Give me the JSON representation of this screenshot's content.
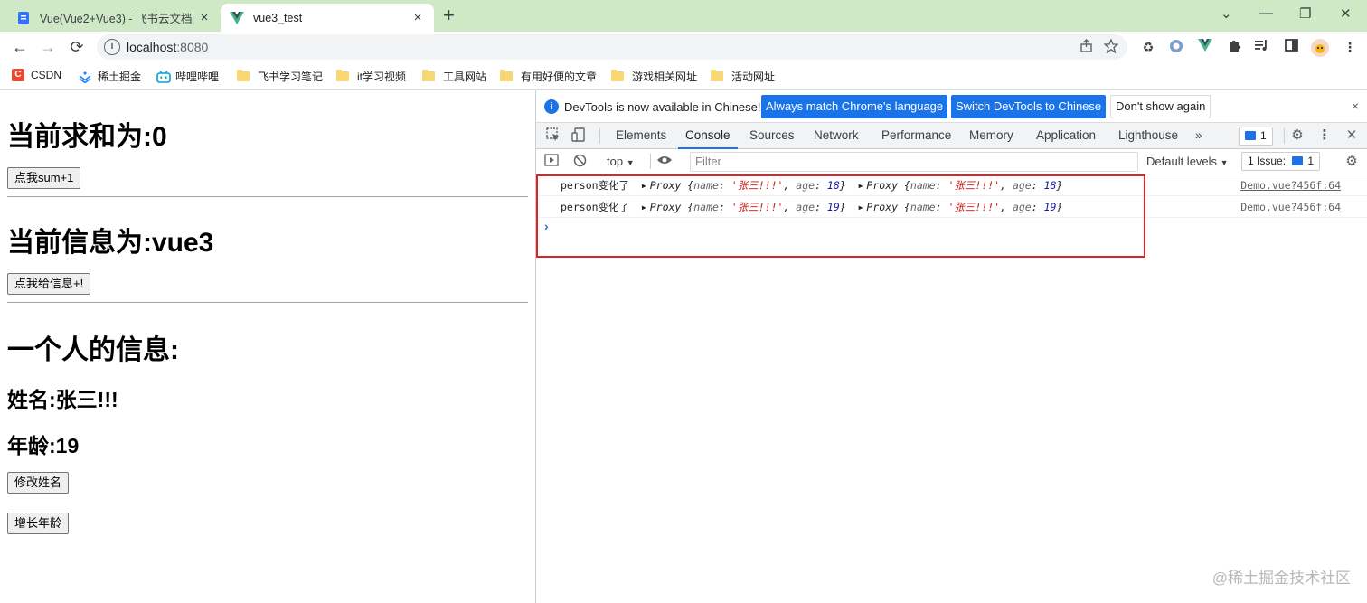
{
  "browser": {
    "tabs": [
      {
        "title": "Vue(Vue2+Vue3) - 飞书云文档",
        "close": "×"
      },
      {
        "title": "vue3_test",
        "close": "×"
      }
    ],
    "new_tab": "+",
    "window_controls": {
      "minimize": "—",
      "restore": "❐",
      "close": "✕",
      "dropdown": "⌄"
    },
    "toolbar": {
      "back": "←",
      "forward": "→",
      "reload": "⟳"
    },
    "omnibox": {
      "host": "localhost",
      "port": ":8080",
      "info": "i"
    },
    "bookmarks": [
      {
        "label": "CSDN",
        "color": "#e8492f"
      },
      {
        "label": "稀土掘金",
        "color": "#1e80ff"
      },
      {
        "label": "哔哩哔哩",
        "color": "#00a1d6"
      },
      {
        "label": "飞书学习笔记"
      },
      {
        "label": "it学习视频"
      },
      {
        "label": "工具网站"
      },
      {
        "label": "有用好便的文章"
      },
      {
        "label": "游戏相关网址"
      },
      {
        "label": "活动网址"
      }
    ],
    "icons": [
      "share-icon",
      "star-icon",
      "recycle-icon",
      "extension-icon",
      "vue-devtools-icon",
      "puzzle-icon",
      "media-icon",
      "sidepanel-icon",
      "avatar",
      "menu-icon"
    ]
  },
  "page": {
    "sum_heading": "当前求和为:0",
    "sum_button": "点我sum+1",
    "msg_heading": "当前信息为:vue3",
    "msg_button": "点我给信息+!",
    "person_heading": "一个人的信息:",
    "name_line": "姓名:张三!!!",
    "age_line": "年龄:19",
    "rename_button": "修改姓名",
    "age_button": "增长年龄"
  },
  "devtools": {
    "infobar": {
      "message": "DevTools is now available in Chinese!",
      "btn_match": "Always match Chrome's language",
      "btn_switch": "Switch DevTools to Chinese",
      "btn_dismiss": "Don't show again",
      "close": "×"
    },
    "tabs": [
      "Elements",
      "Console",
      "Sources",
      "Network",
      "Performance",
      "Memory",
      "Application",
      "Lighthouse"
    ],
    "more": "»",
    "issues_badge": "1",
    "console_toolbar": {
      "context": "top",
      "filter_placeholder": "Filter",
      "levels": "Default levels",
      "issues": "1 Issue:",
      "issues_count": "1"
    },
    "console": {
      "rows": [
        {
          "label": "person变化了",
          "obj": "Proxy",
          "open": "{",
          "k1": "name",
          "v1": "'张三!!!'",
          "k2": "age",
          "v2": "18",
          "close": "}",
          "src": "Demo.vue?456f:64"
        },
        {
          "label": "person变化了",
          "obj": "Proxy",
          "open": "{",
          "k1": "name",
          "v1": "'张三!!!'",
          "k2": "age",
          "v2": "19",
          "close": "}",
          "src": "Demo.vue?456f:64"
        }
      ],
      "prompt": "›"
    },
    "highlight_color": "#e02424"
  },
  "watermark": "@稀土掘金技术社区"
}
